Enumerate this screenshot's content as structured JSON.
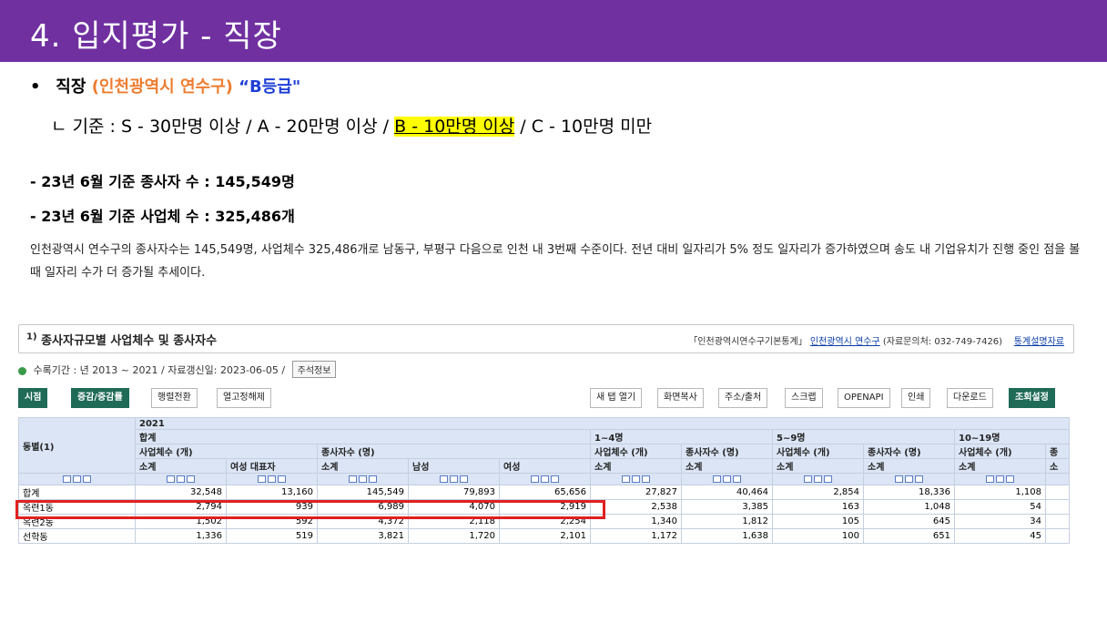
{
  "slide": {
    "title": "4. 입지평가 - 직장",
    "bullet_symbol": "•",
    "bullet_label": "직장",
    "bullet_region": "(인천광역시 연수구)",
    "bullet_grade": "“B등급\"",
    "criteria_prefix": "ㄴ 기준 : S - 30만명 이상 / A - 20만명 이상 /",
    "criteria_highlight": "B - 10만명 이상",
    "criteria_suffix": "/ C - 10만명 미만",
    "stat_workers": "- 23년 6월 기준 종사자 수 : 145,549명",
    "stat_businesses": "- 23년 6월 기준 사업체 수 : 325,486개",
    "paragraph": "인천광역시 연수구의 종사자수는 145,549명, 사업체수 325,486개로 남동구, 부평구 다음으로 인천 내 3번째 수준이다. 전년 대비 일자리가 5% 정도 일자리가 증가하였으며 송도 내 기업유치가 진행 중인 점을 볼 때 일자리 수가 더 증가될 추세이다."
  },
  "panel": {
    "title_sup": "1)",
    "title": "종사자규모별 사업체수 및 종사자수",
    "source_book": "「인천광역시연수구기본통계」",
    "source_org": "인천광역시 연수구",
    "source_contact": "(자료문의처: 032-749-7426)",
    "source_link": "통계설명자료",
    "period": "수록기간 : 년 2013 ~ 2021 / 자료갱신일: 2023-06-05 /",
    "note_button": "주석정보",
    "toolbar_left": [
      "시점",
      "증감/증감률",
      "행렬전환",
      "열고정해제"
    ],
    "toolbar_right": [
      "새 탭 열기",
      "화면복사",
      "주소/출처",
      "스크랩",
      "OPENAPI",
      "인쇄",
      "다운로드",
      "조회설정"
    ]
  },
  "table": {
    "year": "2021",
    "dong_header": "동별(1)",
    "groups": [
      "합계",
      "1~4명",
      "5~9명",
      "10~19명"
    ],
    "subgroups": [
      "사업체수 (개)",
      "종사자수 (명)",
      "사업체수 (개)",
      "종사자수 (명)",
      "사업체수 (개)",
      "종사자수 (명)",
      "사업체수 (개)",
      "종"
    ],
    "columns": [
      "소계",
      "여성 대표자",
      "소계",
      "남성",
      "여성",
      "소계",
      "소계",
      "소계",
      "소계",
      "소계",
      "소"
    ],
    "rows": [
      {
        "name": "합계",
        "values": [
          "32,548",
          "13,160",
          "145,549",
          "79,893",
          "65,656",
          "27,827",
          "40,464",
          "2,854",
          "18,336",
          "1,108",
          ""
        ]
      },
      {
        "name": "옥련1동",
        "values": [
          "2,794",
          "939",
          "6,989",
          "4,070",
          "2,919",
          "2,538",
          "3,385",
          "163",
          "1,048",
          "54",
          ""
        ]
      },
      {
        "name": "옥련2동",
        "values": [
          "1,502",
          "592",
          "4,372",
          "2,118",
          "2,254",
          "1,340",
          "1,812",
          "105",
          "645",
          "34",
          ""
        ]
      },
      {
        "name": "선학동",
        "values": [
          "1,336",
          "519",
          "3,821",
          "1,720",
          "2,101",
          "1,172",
          "1,638",
          "100",
          "651",
          "45",
          ""
        ]
      }
    ]
  },
  "colors": {
    "title_bar": "#7030a0",
    "region": "#ed7d31",
    "grade": "#1f3fd6",
    "highlight": "#ffff00",
    "table_header": "#dbe5f5",
    "callout": "#e02020"
  }
}
